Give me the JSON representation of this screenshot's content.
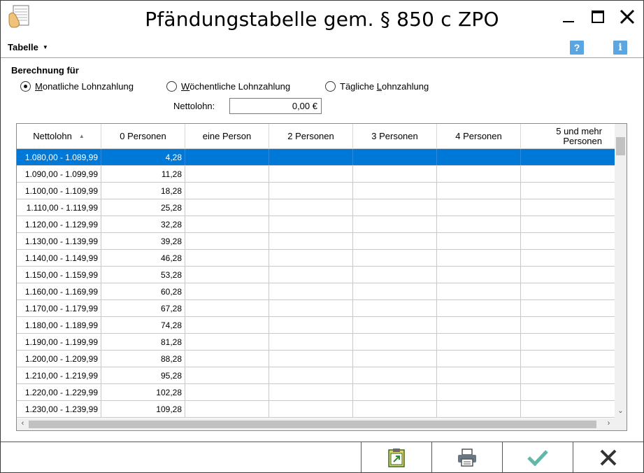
{
  "window": {
    "title": "Pfändungstabelle gem. § 850 c ZPO"
  },
  "menu": {
    "tabelle_label": "Tabelle",
    "help_label": "?",
    "info_label": "i"
  },
  "calc": {
    "section_label": "Berechnung für",
    "options": [
      {
        "pre": "",
        "underlined": "M",
        "post": "onatliche Lohnzahlung",
        "checked": true
      },
      {
        "pre": "",
        "underlined": "W",
        "post": "öchentliche Lohnzahlung",
        "checked": false
      },
      {
        "pre": "Tägliche ",
        "underlined": "L",
        "post": "ohnzahlung",
        "checked": false
      }
    ],
    "net_label": "Nettolohn:",
    "net_value": "0,00 €"
  },
  "table": {
    "columns": [
      "Nettolohn",
      "0 Personen",
      "eine Person",
      "2 Personen",
      "3 Personen",
      "4 Personen",
      "5 und mehr Personen"
    ],
    "sort_indicator": "▲",
    "rows": [
      [
        "1.080,00 - 1.089,99",
        "4,28",
        "",
        "",
        "",
        "",
        ""
      ],
      [
        "1.090,00 - 1.099,99",
        "11,28",
        "",
        "",
        "",
        "",
        ""
      ],
      [
        "1.100,00 - 1.109,99",
        "18,28",
        "",
        "",
        "",
        "",
        ""
      ],
      [
        "1.110,00 - 1.119,99",
        "25,28",
        "",
        "",
        "",
        "",
        ""
      ],
      [
        "1.120,00 - 1.129,99",
        "32,28",
        "",
        "",
        "",
        "",
        ""
      ],
      [
        "1.130,00 - 1.139,99",
        "39,28",
        "",
        "",
        "",
        "",
        ""
      ],
      [
        "1.140,00 - 1.149,99",
        "46,28",
        "",
        "",
        "",
        "",
        ""
      ],
      [
        "1.150,00 - 1.159,99",
        "53,28",
        "",
        "",
        "",
        "",
        ""
      ],
      [
        "1.160,00 - 1.169,99",
        "60,28",
        "",
        "",
        "",
        "",
        ""
      ],
      [
        "1.170,00 - 1.179,99",
        "67,28",
        "",
        "",
        "",
        "",
        ""
      ],
      [
        "1.180,00 - 1.189,99",
        "74,28",
        "",
        "",
        "",
        "",
        ""
      ],
      [
        "1.190,00 - 1.199,99",
        "81,28",
        "",
        "",
        "",
        "",
        ""
      ],
      [
        "1.200,00 - 1.209,99",
        "88,28",
        "",
        "",
        "",
        "",
        ""
      ],
      [
        "1.210,00 - 1.219,99",
        "95,28",
        "",
        "",
        "",
        "",
        ""
      ],
      [
        "1.220,00 - 1.229,99",
        "102,28",
        "",
        "",
        "",
        "",
        ""
      ],
      [
        "1.230,00 - 1.239,99",
        "109,28",
        "",
        "",
        "",
        "",
        ""
      ]
    ],
    "selected_row": 0
  },
  "toolbar": {
    "buttons": [
      {
        "name": "clipboard-export",
        "icon": "clipboard-icon"
      },
      {
        "name": "print",
        "icon": "printer-icon"
      },
      {
        "name": "ok",
        "icon": "checkmark-icon"
      },
      {
        "name": "cancel",
        "icon": "close-x-icon"
      }
    ]
  },
  "colors": {
    "selection": "#0078d7",
    "help_button": "#5aa6e0",
    "ok_check": "#5fb8a8"
  }
}
